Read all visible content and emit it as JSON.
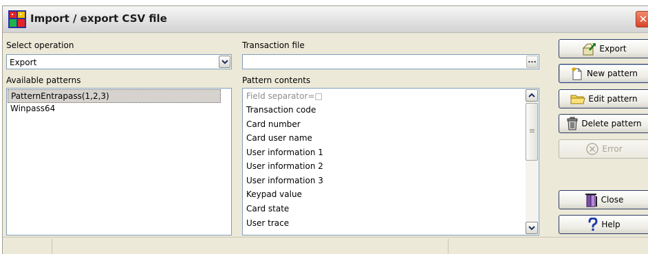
{
  "window": {
    "title": "Import / export CSV file"
  },
  "operation": {
    "label": "Select operation",
    "value": "Export"
  },
  "transaction": {
    "label": "Transaction file",
    "value": "",
    "browse_label": "..."
  },
  "patterns": {
    "label": "Available patterns",
    "items": [
      "PatternEntrapass(1,2,3)",
      "Winpass64"
    ],
    "selected_index": 0
  },
  "pattern_contents": {
    "label": "Pattern contents",
    "items": [
      "Field separator=□",
      "Transaction code",
      "Card number",
      "Card user name",
      "User information 1",
      "User information 2",
      "User information 3",
      "Keypad value",
      "Card state",
      "User trace"
    ]
  },
  "buttons": {
    "export": "Export",
    "new_pattern": "New pattern",
    "edit_pattern": "Edit pattern",
    "delete_pattern": "Delete pattern",
    "error": "Error",
    "close": "Close",
    "help": "Help"
  },
  "icons": {
    "app": "app-icon",
    "export": "export-icon",
    "new_pattern": "new-document-icon",
    "edit_pattern": "folder-icon",
    "delete_pattern": "trash-icon",
    "error": "error-circle-icon",
    "close": "door-exit-icon",
    "help": "question-icon"
  },
  "colors": {
    "close_button": "#d8442a",
    "window_bg": "#ece9d8",
    "field_border": "#7f9db9"
  }
}
